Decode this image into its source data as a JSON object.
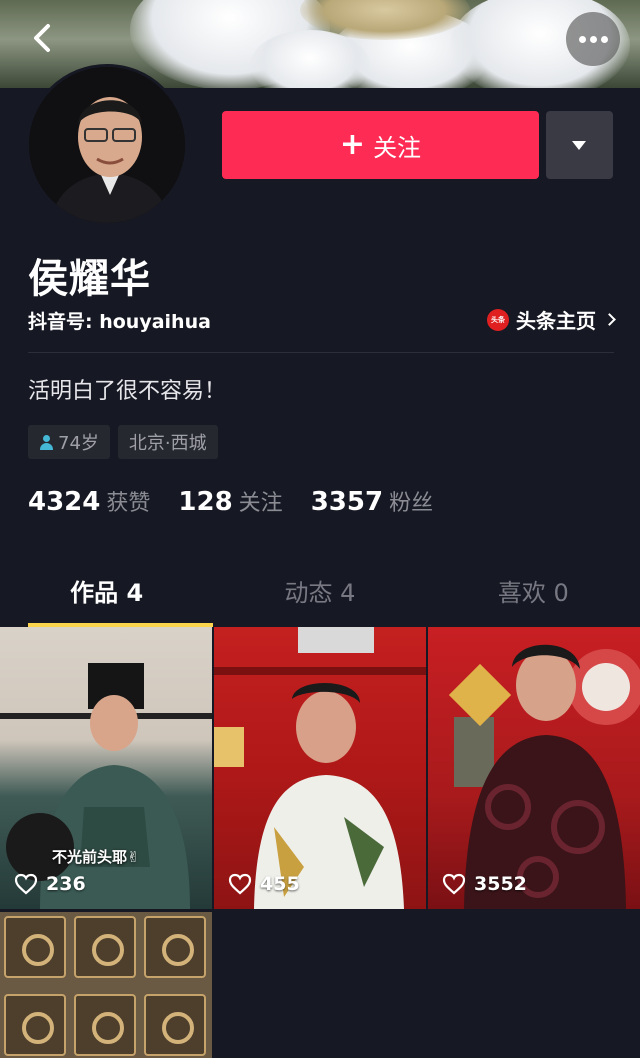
{
  "header": {
    "back_icon": "back-arrow-icon",
    "more_icon": "more-dots-icon"
  },
  "profile": {
    "name": "侯耀华",
    "douyin_id": "抖音号: houyaihua",
    "toutiao_badge": "头条",
    "toutiao_link": "头条主页",
    "bio": "活明白了很不容易！"
  },
  "actions": {
    "follow_plus": "+",
    "follow_label": "关注"
  },
  "tags": {
    "age": "74岁",
    "location": "北京·西城"
  },
  "stats": {
    "likes_count": "4324",
    "likes_label": "获赞",
    "following_count": "128",
    "following_label": "关注",
    "followers_count": "3357",
    "followers_label": "粉丝"
  },
  "tabs": [
    {
      "label": "作品 4",
      "active": true
    },
    {
      "label": "动态 4",
      "active": false
    },
    {
      "label": "喜欢 0",
      "active": false
    }
  ],
  "videos": [
    {
      "likes": "236",
      "caption": "不光前头耶✌"
    },
    {
      "likes": "455"
    },
    {
      "likes": "3552"
    },
    {
      "likes": ""
    }
  ],
  "colors": {
    "background": "#161823",
    "accent_follow": "#fe2c55",
    "tab_indicator": "#fcd34d"
  }
}
